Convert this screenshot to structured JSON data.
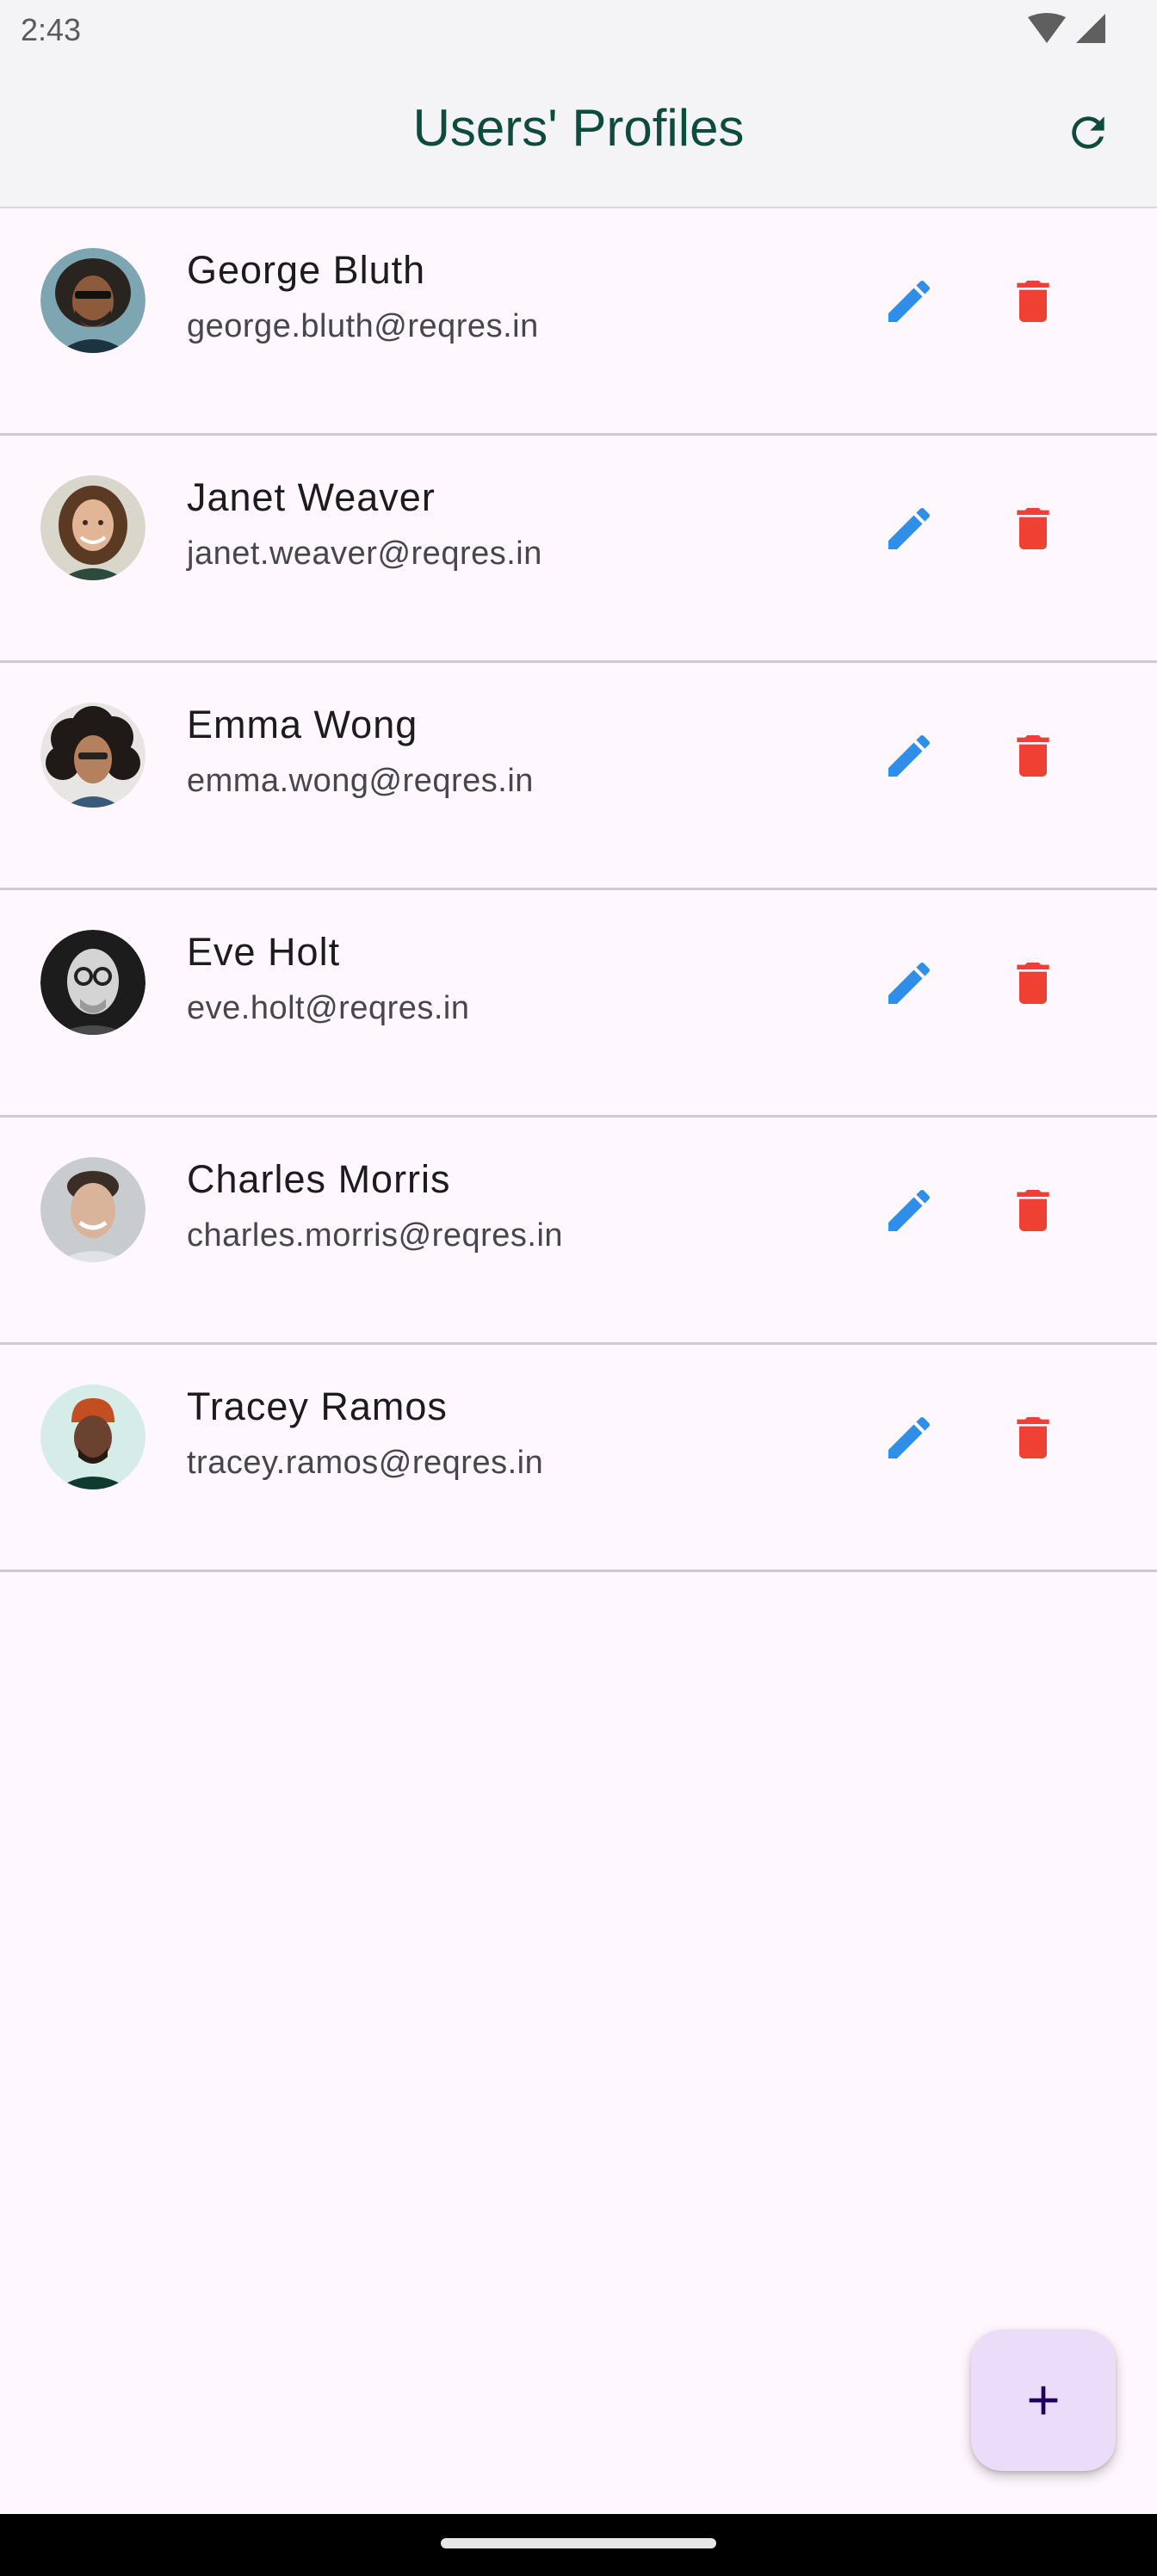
{
  "status_bar": {
    "time": "2:43",
    "icons": [
      "wifi-icon",
      "cell-signal-icon"
    ]
  },
  "app_bar": {
    "title": "Users' Profiles",
    "refresh_icon": "refresh-icon"
  },
  "colors": {
    "title": "#0d4b3c",
    "edit": "#2e8ee8",
    "delete": "#ef4034",
    "background": "#fef7fd",
    "fab": "#ebdcf9"
  },
  "users": [
    {
      "name": "George Bluth",
      "email": "george.bluth@reqres.in"
    },
    {
      "name": "Janet Weaver",
      "email": "janet.weaver@reqres.in"
    },
    {
      "name": "Emma Wong",
      "email": "emma.wong@reqres.in"
    },
    {
      "name": "Eve Holt",
      "email": "eve.holt@reqres.in"
    },
    {
      "name": "Charles Morris",
      "email": "charles.morris@reqres.in"
    },
    {
      "name": "Tracey Ramos",
      "email": "tracey.ramos@reqres.in"
    }
  ],
  "row_actions": {
    "edit_icon": "pencil-icon",
    "delete_icon": "trash-icon"
  },
  "fab": {
    "icon": "plus-icon"
  }
}
